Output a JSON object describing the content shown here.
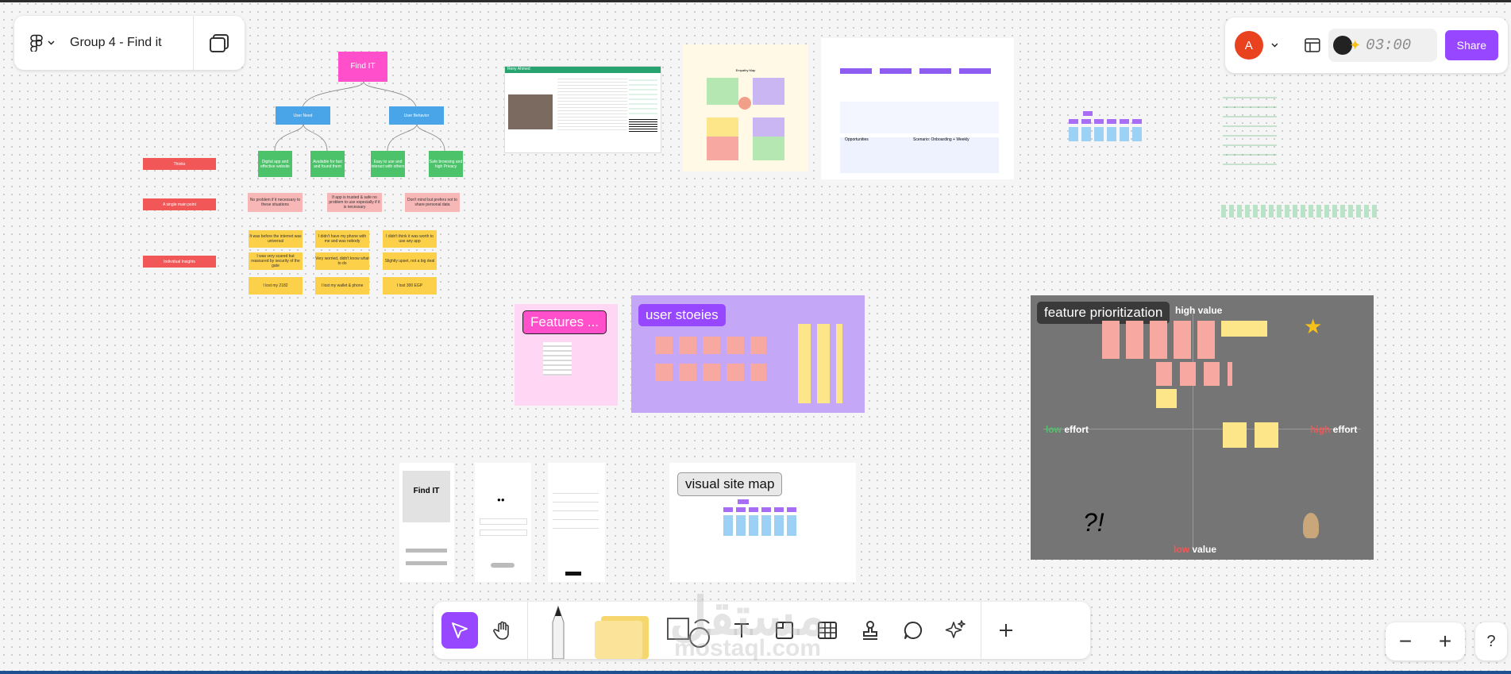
{
  "file": {
    "title": "Group 4 - Find it"
  },
  "user": {
    "initial": "A"
  },
  "timer": {
    "value": "03:00"
  },
  "buttons": {
    "share": "Share"
  },
  "canvas": {
    "tree": {
      "root": "Find IT",
      "groups": [
        "User Need",
        "User Behavior"
      ],
      "left_labels": [
        "Thinks",
        "A single main point",
        "Individual Insights"
      ],
      "needs": [
        "Digital app and effective website",
        "Available for fast and found them",
        "Easy to use and interact with others",
        "Safe browsing and high Privacy"
      ],
      "points": [
        "No problem if it necessary to these situations",
        "If app is trusted & safe no problem to use especially if it is necessary",
        "Don't mind but prefers not to share personal data"
      ],
      "insights": [
        "It was before the internet was universal",
        "I didn't have my phone with me and was nobody",
        "I didn't think it was worth to use any app",
        "I was very scared but reassured by security of the gate",
        "Very worried, didn't know what to do",
        "Slightly upset, not a big deal",
        "I lost my 2182",
        "I lost my wallet & phone",
        "I lost 300 EGP"
      ]
    },
    "persona": {
      "name": "Reny Ahmed"
    },
    "empathy": {
      "title": "Empathy Map"
    },
    "journey": {
      "opportunities": "Opportunities",
      "scenario": "Scenario: Onboarding + Weekly"
    },
    "features": {
      "label": "Features ..."
    },
    "user_stories": {
      "label": "user stoeies"
    },
    "site_map": {
      "label": "visual site map"
    },
    "prioritization": {
      "label": "feature prioritization",
      "top": "high value",
      "bottom_low": "low",
      "bottom_value": "value",
      "left_low": "low",
      "left_effort": "effort",
      "right_high": "high",
      "right_effort": "effort",
      "marks": "?!"
    },
    "wireframes": {
      "app_name": "Find IT"
    }
  },
  "zoom": {
    "out": "−",
    "in": "+"
  },
  "help": "?",
  "watermark": {
    "ar": "مستقل",
    "en": "mostaql.com"
  },
  "colors": {
    "accent": "#9747ff",
    "pink": "#ff4fcb",
    "blue": "#4aa5e8",
    "green": "#4cc26a",
    "red": "#f25757",
    "salmon": "#f7b7b7",
    "yellow": "#fdd04a"
  }
}
